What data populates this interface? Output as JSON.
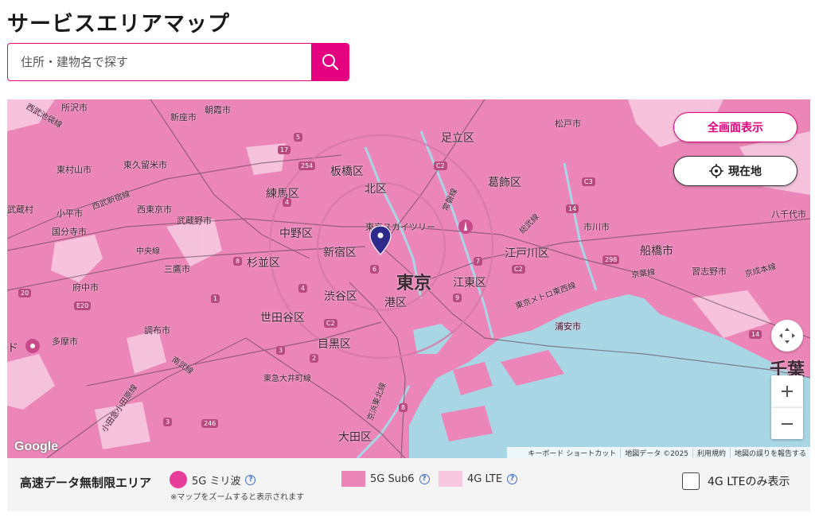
{
  "page_title": "サービスエリアマップ",
  "search": {
    "placeholder": "住所・建物名で探す",
    "button_icon": "search-icon"
  },
  "map": {
    "buttons": {
      "fullscreen": "全画面表示",
      "current_location": "現在地"
    },
    "labels": {
      "wards": [
        "足立区",
        "板橋区",
        "葛飾区",
        "北区",
        "練馬区",
        "中野区",
        "新宿区",
        "江戸川区",
        "杉並区",
        "江東区",
        "渋谷区",
        "港区",
        "世田谷区",
        "目黒区",
        "大田区"
      ],
      "big": [
        "東京",
        "千葉"
      ],
      "cities": [
        "所沢市",
        "朝霞市",
        "新座市",
        "松戸市",
        "東村山市",
        "東久留米市",
        "西東京市",
        "武蔵野市",
        "小平市",
        "国分寺市",
        "市川市",
        "八千代市",
        "船橋市",
        "三鷹市",
        "府中市",
        "調布市",
        "多摩市",
        "習志野市",
        "浦安市"
      ],
      "lines": [
        "西武池袋線",
        "西武新宿線",
        "中央線",
        "京葉線",
        "京成本線",
        "総武線",
        "南武線",
        "東急大井町線",
        "京浜東北線",
        "小田急小田原線",
        "東京メトロ東西線",
        "常磐線",
        "東京スカイツリー"
      ],
      "edge": [
        "武蔵村",
        "ド"
      ]
    },
    "road_badges": [
      "5",
      "17",
      "254",
      "C2",
      "4",
      "C3",
      "14",
      "7",
      "6",
      "C2",
      "298",
      "8",
      "20",
      "4",
      "9",
      "3",
      "2",
      "C2",
      "E20",
      "1",
      "3",
      "8",
      "246",
      "14"
    ],
    "pin_icon": "location-pin-icon",
    "attribution": {
      "logo": "Google",
      "shortcuts": "キーボード ショートカット",
      "map_data": "地図データ ©2025",
      "terms": "利用規約",
      "report": "地図の誤りを報告する"
    },
    "colors": {
      "sub6": "#ec86b8",
      "lte": "#f7c9e0",
      "water": "#a9d6e5",
      "accent": "#e5007f"
    }
  },
  "legend": {
    "title": "高速データ無制限エリア",
    "items": [
      {
        "label": "5G ミリ波",
        "swatch": "mmwave"
      },
      {
        "label": "5G Sub6",
        "swatch": "sub6"
      },
      {
        "label": "4G LTE",
        "swatch": "lte"
      }
    ],
    "note": "※マップをズームすると表示されます",
    "lte_only_toggle": "4G LTEのみ表示",
    "lte_only_checked": false
  }
}
